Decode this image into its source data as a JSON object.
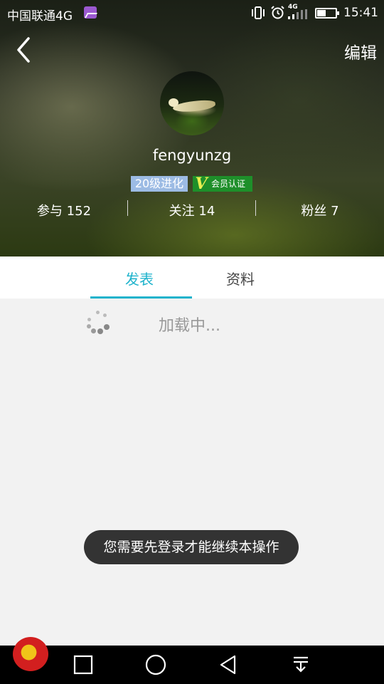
{
  "status_bar": {
    "carrier": "中国联通4G",
    "network_type": "4G",
    "time": "15:41",
    "icons": [
      "gallery-icon",
      "vibrate-icon",
      "alarm-icon",
      "signal-icon",
      "battery-icon"
    ]
  },
  "header": {
    "back_icon": "chevron-left-icon",
    "edit_label": "编辑"
  },
  "profile": {
    "username": "fengyunzg",
    "level_badge": "20级进化",
    "vip_mark": "V",
    "vip_badge": "会员认证",
    "stats": [
      {
        "label": "参与 152"
      },
      {
        "label": "关注 14"
      },
      {
        "label": "粉丝 7"
      }
    ]
  },
  "tabs": [
    {
      "label": "发表",
      "active": true
    },
    {
      "label": "资料",
      "active": false
    }
  ],
  "content": {
    "loading_text": "加载中..."
  },
  "toast": {
    "message": "您需要先登录才能继续本操作"
  },
  "navbar": {
    "buttons": [
      "recents-square-icon",
      "home-circle-icon",
      "back-triangle-icon",
      "notification-pulldown-icon"
    ]
  },
  "colors": {
    "accent": "#1fb3cc",
    "level_badge_bg": "#9cbbe4",
    "vip_badge_bg": "#1e8f2a",
    "toast_bg": "#333333"
  }
}
